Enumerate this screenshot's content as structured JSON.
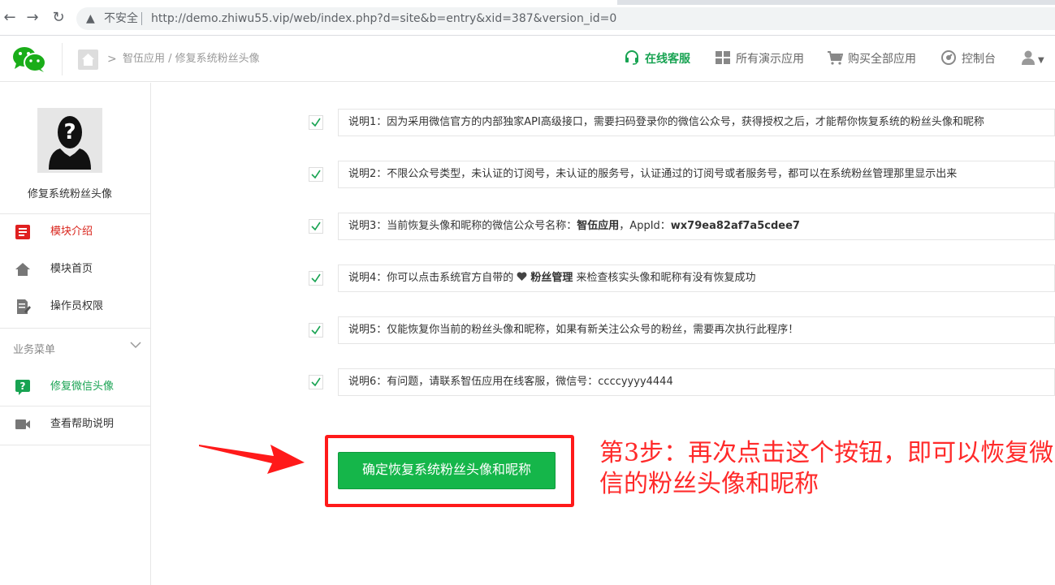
{
  "browser": {
    "security_label": "不安全",
    "url": "http://demo.zhiwu55.vip/web/index.php?d=site&b=entry&xid=387&version_id=0"
  },
  "header": {
    "breadcrumb": "智伍应用 / 修复系统粉丝头像",
    "nav": [
      {
        "label": "在线客服",
        "icon": "headset-icon"
      },
      {
        "label": "所有演示应用",
        "icon": "grid-icon"
      },
      {
        "label": "购买全部应用",
        "icon": "cart-icon"
      },
      {
        "label": "控制台",
        "icon": "dashboard-icon"
      }
    ]
  },
  "sidebar": {
    "module_name": "修复系统粉丝头像",
    "items": [
      {
        "label": "模块介绍",
        "icon": "document-red-icon"
      },
      {
        "label": "模块首页",
        "icon": "home-icon"
      },
      {
        "label": "操作员权限",
        "icon": "edit-doc-icon"
      }
    ],
    "section_title": "业务菜单",
    "section_items": [
      {
        "label": "修复微信头像",
        "icon": "question-green-icon"
      },
      {
        "label": "查看帮助说明",
        "icon": "video-icon"
      }
    ]
  },
  "notes": [
    {
      "text": "说明1：因为采用微信官方的内部独家API高级接口，需要扫码登录你的微信公众号，获得授权之后，才能帮你恢复系统的粉丝头像和昵称"
    },
    {
      "text": "说明2：不限公众号类型，未认证的订阅号，未认证的服务号，认证通过的订阅号或者服务号，都可以在系统粉丝管理那里显示出来"
    },
    {
      "prefix": "说明3：当前恢复头像和昵称的微信公众号名称：",
      "bold1": "智伍应用",
      "mid": "，AppId：",
      "bold2": "wx79ea82af7a5cdee7"
    },
    {
      "prefix": "说明4：你可以点击系统官方自带的 ",
      "bold1": "粉丝管理",
      "suffix": " 来检查核实头像和昵称有没有恢复成功"
    },
    {
      "text": "说明5：仅能恢复你当前的粉丝头像和昵称，如果有新关注公众号的粉丝，需要再次执行此程序！"
    },
    {
      "text": "说明6：有问题，请联系智伍应用在线客服，微信号：ccccyyyy4444"
    }
  ],
  "confirm_button": "确定恢复系统粉丝头像和昵称",
  "annotation": "第3步：再次点击这个按钮，即可以恢复微信的粉丝头像和昵称",
  "colors": {
    "green": "#15b64a",
    "red": "#ff2a2a"
  }
}
